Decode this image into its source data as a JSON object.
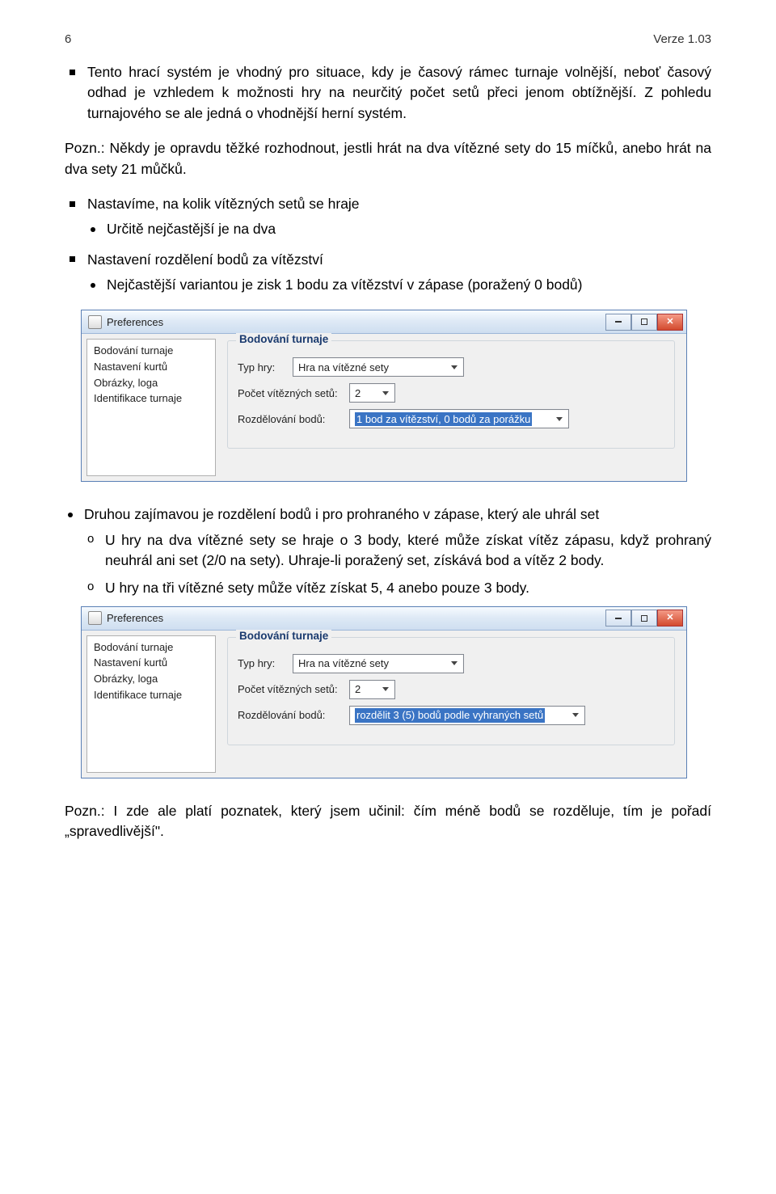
{
  "header": {
    "page": "6",
    "version": "Verze 1.03"
  },
  "para1": "Tento hrací systém je vhodný pro situace, kdy je časový rámec turnaje volnější, neboť časový odhad je vzhledem k možnosti hry na neurčitý počet setů přeci jenom obtížnější. Z pohledu turnajového se ale jedná o vhodnější herní systém.",
  "pozn1_prefix": "Pozn.:",
  "pozn1": "Někdy je opravdu těžké rozhodnout, jestli hrát na dva vítězné sety do 15 míčků, anebo hrát na dva sety 21 můčků.",
  "bullets_a": {
    "b1": "Nastavíme, na kolik vítězných setů se hraje",
    "b1_sub": "Určitě nejčastější je na dva",
    "b2": "Nastavení rozdělení bodů za vítězství",
    "b2_sub": "Nejčastější variantou je zisk 1 bodu za vítězství v zápase (poražený 0 bodů)"
  },
  "win": {
    "title": "Preferences",
    "side": [
      "Bodování turnaje",
      "Nastavení kurtů",
      "Obrázky, loga",
      "Identifikace turnaje"
    ],
    "group_title": "Bodování turnaje",
    "lbl_type": "Typ hry:",
    "val_type": "Hra na vítězné sety",
    "lbl_sets": "Počet vítězných setů:",
    "val_sets": "2",
    "lbl_points": "Rozdělování bodů:",
    "val_points_1": "1 bod za vítězství, 0 bodů za porážku",
    "val_points_2": "rozdělit 3 (5) bodů podle vyhraných setů"
  },
  "bullets_b": {
    "b1": "Druhou zajímavou je rozdělení bodů i pro prohraného v zápase, který ale uhrál set",
    "b1_s1": "U hry na dva vítězné sety se hraje o 3 body, které může získat vítěz zápasu, když prohraný neuhrál ani set (2/0 na sety). Uhraje-li poražený set, získává bod a vítěz 2 body.",
    "b1_s2": "U hry na tři vítězné sety může vítěz získat 5, 4 anebo pouze 3 body."
  },
  "pozn2_prefix": "Pozn.:",
  "pozn2": "I zde ale platí poznatek, který jsem učinil: čím méně bodů se rozděluje, tím je pořadí „spravedlivější\"."
}
